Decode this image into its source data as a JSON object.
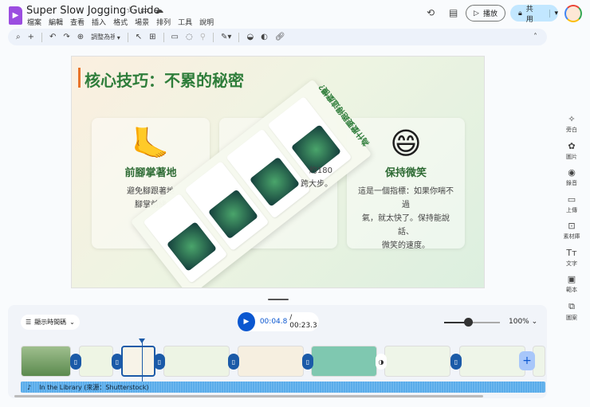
{
  "app": {
    "title": "Super Slow Jogging Guide",
    "menu": [
      "檔案",
      "編輯",
      "查看",
      "插入",
      "格式",
      "場景",
      "排列",
      "工具",
      "說明"
    ],
    "fit_label": "調整為視窗大小",
    "play_label": "播放",
    "share_label": "共用"
  },
  "slide": {
    "title": "核心技巧：不累的秘密",
    "cards": [
      {
        "title": "前腳掌著地",
        "body_lines": [
          "避免腳跟著地",
          "腳掌前緣"
        ]
      },
      {
        "title": "",
        "body_lines": [
          "約180",
          "跨大步。"
        ]
      },
      {
        "title": "保持微笑",
        "body_lines": [
          "這是一個指標：如果你喘不過",
          "氣，就太快了。保持能說話、",
          "微笑的速度。"
        ]
      }
    ],
    "overlay_title": "為什麼要跑得這麼慢？"
  },
  "sidebar": [
    {
      "label": "旁白",
      "icon": "sparkle"
    },
    {
      "label": "圖片",
      "icon": "image-sparkle"
    },
    {
      "label": "錄音",
      "icon": "record"
    },
    {
      "label": "上傳",
      "icon": "folder"
    },
    {
      "label": "素材庫",
      "icon": "stock"
    },
    {
      "label": "文字",
      "icon": "text"
    },
    {
      "label": "範本",
      "icon": "template"
    },
    {
      "label": "圖案",
      "icon": "shapes"
    }
  ],
  "timeline": {
    "timecode_toggle": "顯示時間碼",
    "current_time": "00:04.8",
    "total_time": "/ 00:23.3",
    "zoom": "100%",
    "audio_track": "In the Library (來源：Shutterstock)",
    "clips": 8
  },
  "colors": {
    "accent": "#0b57d0",
    "brand": "#9b4de0",
    "title_green": "#2e7d3a"
  }
}
